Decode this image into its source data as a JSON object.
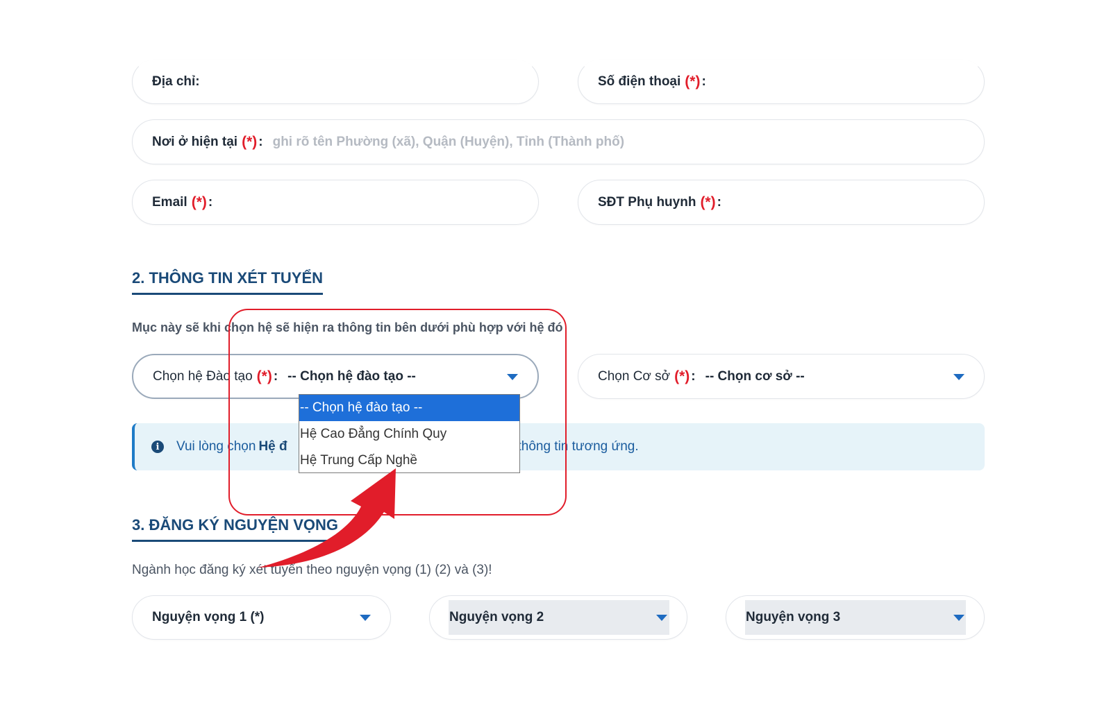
{
  "contact": {
    "address_label": "Địa chỉ:",
    "phone_label": "Số điện thoại",
    "residence_label": "Nơi ở hiện tại",
    "residence_placeholder": "ghi rõ tên Phường (xã), Quận (Huyện), Tỉnh (Thành phố)",
    "email_label": "Email",
    "parent_phone_label": "SĐT Phụ huynh",
    "required_mark": "(*)",
    "colon": ":"
  },
  "section2": {
    "title": "2. THÔNG TIN XÉT TUYỂN",
    "hint": "Mục này sẽ khi chọn hệ sẽ hiện ra thông tin bên dưới phù hợp với hệ đó",
    "training_label": "Chọn hệ Đào tạo",
    "training_value": "-- Chọn hệ đào tạo --",
    "campus_label": "Chọn Cơ sở",
    "campus_value": "-- Chọn cơ sở --",
    "dropdown_options": [
      "-- Chọn hệ đào tạo --",
      "Hệ Cao Đẳng Chính Quy",
      "Hệ Trung Cấp Nghề"
    ],
    "info_prefix": "Vui lòng chọn",
    "info_bold": "Hệ đ",
    "info_suffix": "g thông tin tương ứng."
  },
  "section3": {
    "title": "3. ĐĂNG KÝ NGUYỆN VỌNG",
    "subtitle": "Ngành học đăng ký xét tuyển theo nguyện vọng (1) (2) và (3)!",
    "choice1": "Nguyện vọng 1 (*)",
    "choice2": "Nguyện vọng 2",
    "choice3": "Nguyện vọng 3"
  },
  "colors": {
    "accent": "#1a4a78",
    "required": "#e11d2a",
    "selected": "#1e6fd9",
    "annotation": "#e11d2a"
  }
}
